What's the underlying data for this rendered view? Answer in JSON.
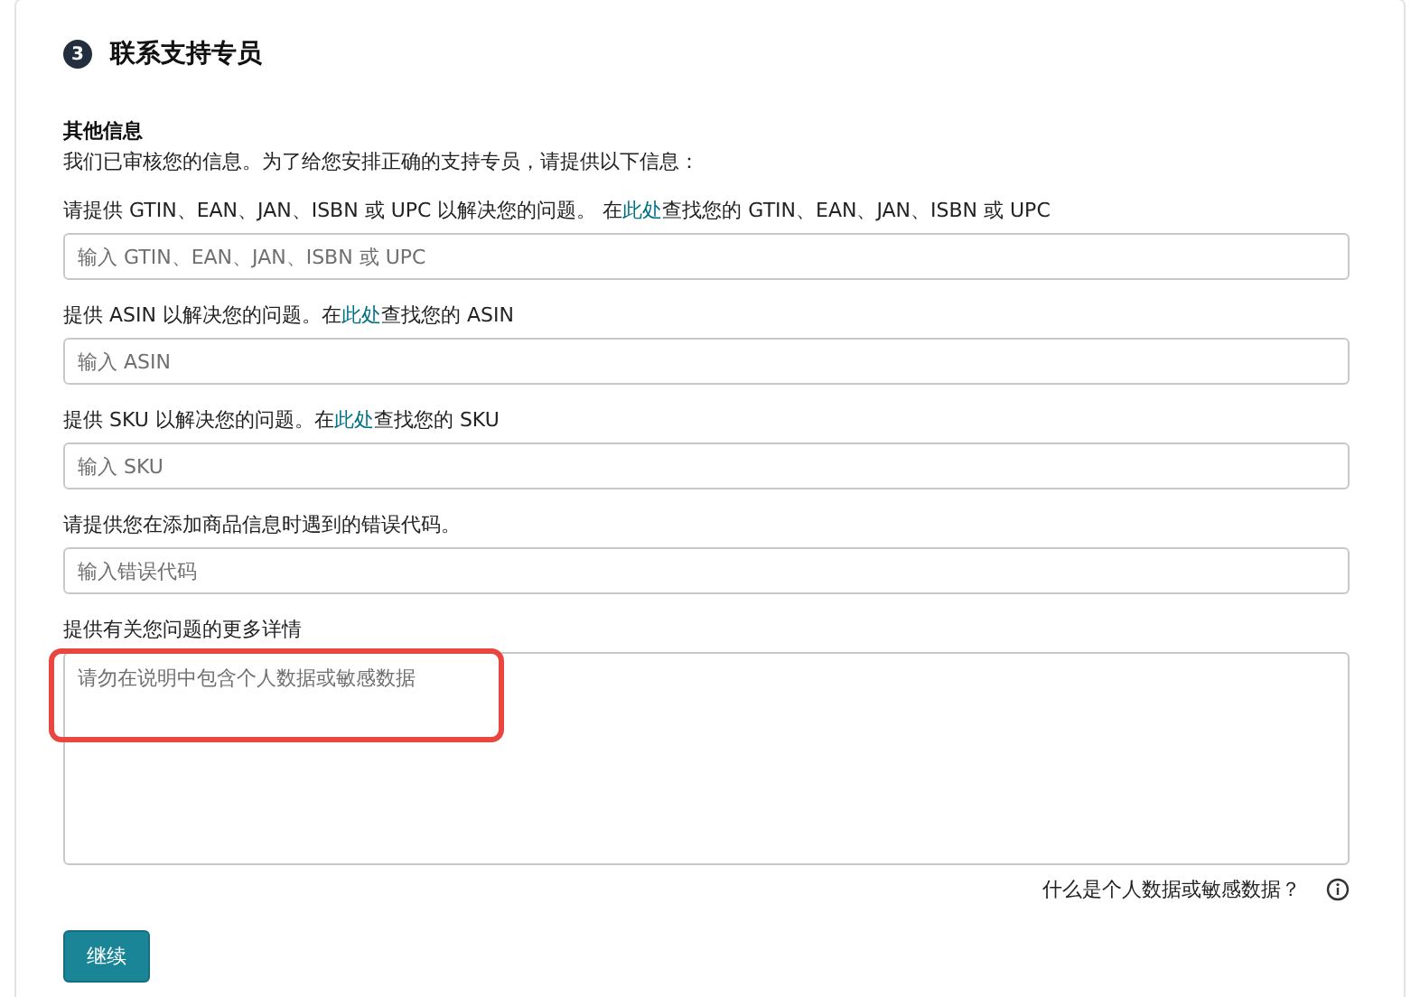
{
  "step": {
    "number": "3",
    "title": "联系支持专员"
  },
  "section": {
    "heading": "其他信息",
    "description": "我们已审核您的信息。为了给您安排正确的支持专员，请提供以下信息："
  },
  "fields": [
    {
      "kind": "input",
      "label_before": "请提供 GTIN、EAN、JAN、ISBN 或 UPC 以解决您的问题。 在",
      "link": "此处",
      "label_after": "查找您的 GTIN、EAN、JAN、ISBN 或 UPC",
      "placeholder": "输入 GTIN、EAN、JAN、ISBN 或 UPC"
    },
    {
      "kind": "input",
      "label_before": "提供 ASIN 以解决您的问题。在",
      "link": "此处",
      "label_after": "查找您的 ASIN",
      "placeholder": "输入 ASIN"
    },
    {
      "kind": "input",
      "label_before": "提供 SKU 以解决您的问题。在",
      "link": "此处",
      "label_after": "查找您的 SKU",
      "placeholder": "输入 SKU"
    },
    {
      "kind": "input",
      "label_before": "请提供您在添加商品信息时遇到的错误代码。",
      "placeholder": "输入错误代码"
    },
    {
      "kind": "textarea",
      "label_before": "提供有关您问题的更多详情",
      "placeholder": "请勿在说明中包含个人数据或敏感数据",
      "highlighted": true
    }
  ],
  "help_link": "什么是个人数据或敏感数据？",
  "button": "继续"
}
